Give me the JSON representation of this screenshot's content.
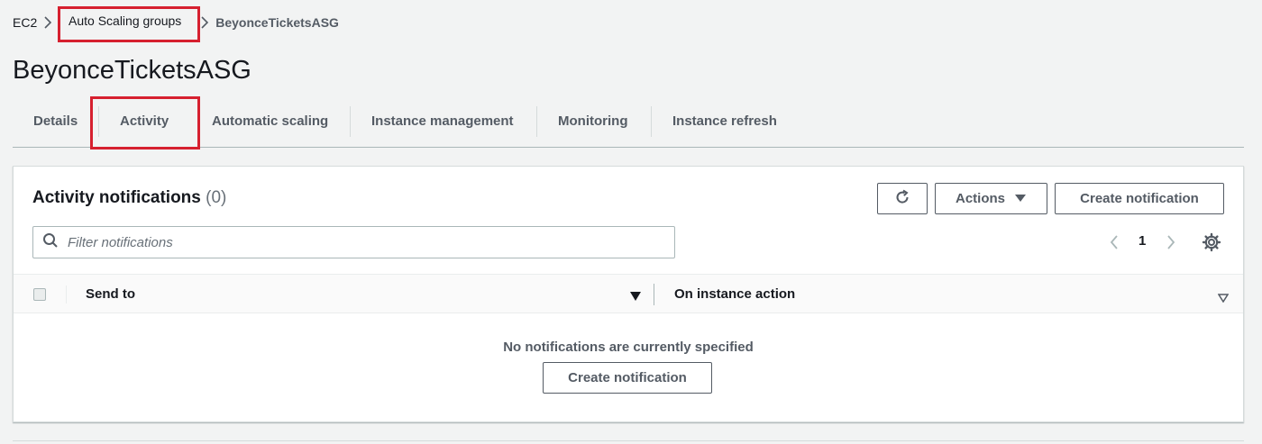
{
  "breadcrumb": {
    "items": [
      "EC2",
      "Auto Scaling groups"
    ],
    "current": "BeyonceTicketsASG"
  },
  "page": {
    "title": "BeyonceTicketsASG"
  },
  "tabs": [
    {
      "label": "Details"
    },
    {
      "label": "Activity"
    },
    {
      "label": "Automatic scaling"
    },
    {
      "label": "Instance management"
    },
    {
      "label": "Monitoring"
    },
    {
      "label": "Instance refresh"
    }
  ],
  "panel": {
    "title": "Activity notifications",
    "count": "(0)",
    "actions_label": "Actions",
    "create_label": "Create notification",
    "filter_placeholder": "Filter notifications",
    "page_number": "1",
    "columns": [
      "Send to",
      "On instance action"
    ],
    "empty_message": "No notifications are currently specified",
    "empty_create_label": "Create notification"
  },
  "icons": {
    "refresh": "refresh-icon",
    "caret": "caret-down-icon",
    "search": "search-icon",
    "settings": "gear-icon"
  },
  "colors": {
    "highlight": "#d6202f",
    "text": "#16191f",
    "muted": "#545b64",
    "background": "#f2f3f3"
  }
}
